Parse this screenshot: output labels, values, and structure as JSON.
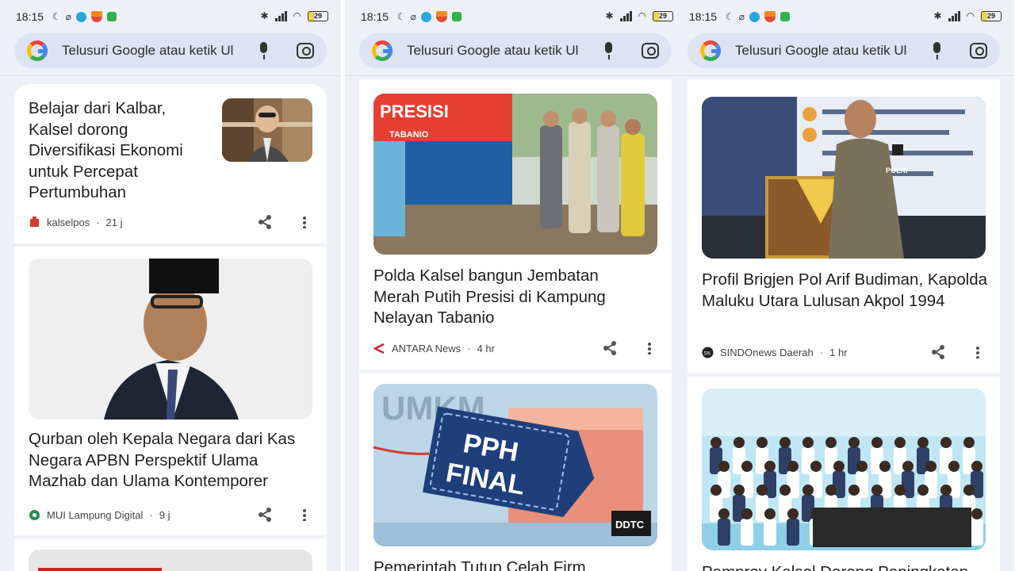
{
  "status_bar": {
    "time": "18:15",
    "battery": "29"
  },
  "search": {
    "placeholder": "Telusuri Google atau ketik Ul"
  },
  "panels": [
    {
      "cards": [
        {
          "title": "Belajar dari Kalbar, Kalsel dorong Diversifikasi Ekonomi untuk Percepat Pertumbuhan",
          "source": "kalselpos",
          "age": "21 j"
        },
        {
          "title": "Qurban oleh Kepala Negara dari Kas Negara APBN Perspektif Ulama Mazhab dan Ulama Kontemporer",
          "source": "MUI Lampung Digital",
          "age": "9 j"
        }
      ]
    },
    {
      "cards": [
        {
          "title": "Polda Kalsel bangun Jembatan Merah Putih Presisi di Kampung Nelayan Tabanio",
          "source": "ANTARA News",
          "age": "4 hr",
          "image_text": [
            "PRESISI",
            "TABANIO"
          ]
        },
        {
          "title": "Pemerintah Tutup Celah Firm",
          "image_text": [
            "UMKM",
            "PPH",
            "FINAL",
            "DDTC"
          ]
        }
      ]
    },
    {
      "cards": [
        {
          "title": "Profil Brigjen Pol Arif Budiman, Kapolda Maluku Utara Lulusan Akpol 1994",
          "source": "SINDOnews Daerah",
          "age": "1 hr",
          "image_text": [
            "POLRI"
          ]
        },
        {
          "title": "Pemprov Kalsel Dorong Peningkatan"
        }
      ]
    }
  ],
  "colors": {
    "panel_bg": "#edf0f7",
    "search_bg": "#dde3f2",
    "card_bg": "#ffffff"
  }
}
